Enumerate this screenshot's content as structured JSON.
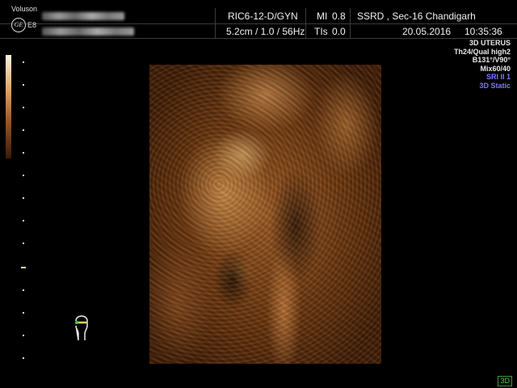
{
  "header": {
    "brand": "Voluson",
    "brand_sub": "E8",
    "ge_logo_text": "GE",
    "probe": "RIC6-12-D/GYN",
    "mi_label": "MI",
    "mi_value": "0.8",
    "institution": "SSRD , Sec-16 Chandigarh",
    "settings": "5.2cm / 1.0 / 56Hz",
    "tis_label": "TIs",
    "tis_value": "0.0",
    "date": "20.05.2016",
    "time": "10:35:36"
  },
  "info": {
    "exam": "3D UTERUS",
    "quality": "Th24/Qual high2",
    "angles": "B131°/V90°",
    "mix": "Mix60/40",
    "sri": "SRI II 1",
    "mode": "3D Static"
  },
  "colors": {
    "info_white": "#e8e8e8",
    "info_blue": "#7b7bff",
    "badge_green": "#4ad04a"
  },
  "badge": "3D"
}
